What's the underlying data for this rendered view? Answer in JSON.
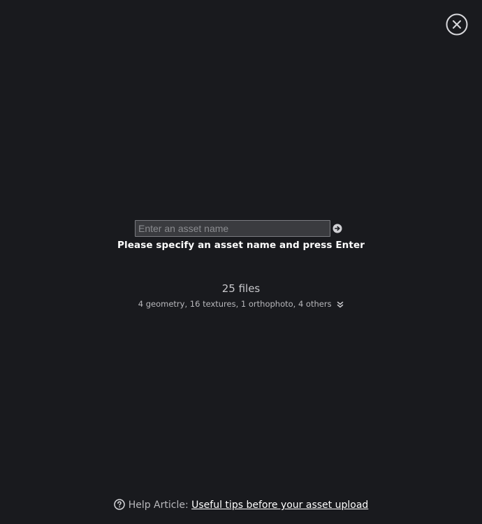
{
  "close_icon": "close-icon",
  "asset_name": {
    "value": "",
    "placeholder": "Enter an asset name",
    "submit_icon": "arrow-right-circle-icon"
  },
  "hint": "Please specify an asset name and press Enter",
  "files": {
    "count_label": "25 files",
    "summary": "4 geometry, 16 textures, 1 orthophoto, 4 others",
    "expand_icon": "chevron-double-down-icon"
  },
  "help": {
    "icon": "question-circle-icon",
    "prefix": "Help Article:",
    "link_text": "Useful tips before your asset upload"
  },
  "colors": {
    "background": "#191a1e",
    "input_background": "#3a3b3f",
    "text_primary": "#ffffff",
    "text_secondary": "#b8b8bc"
  }
}
